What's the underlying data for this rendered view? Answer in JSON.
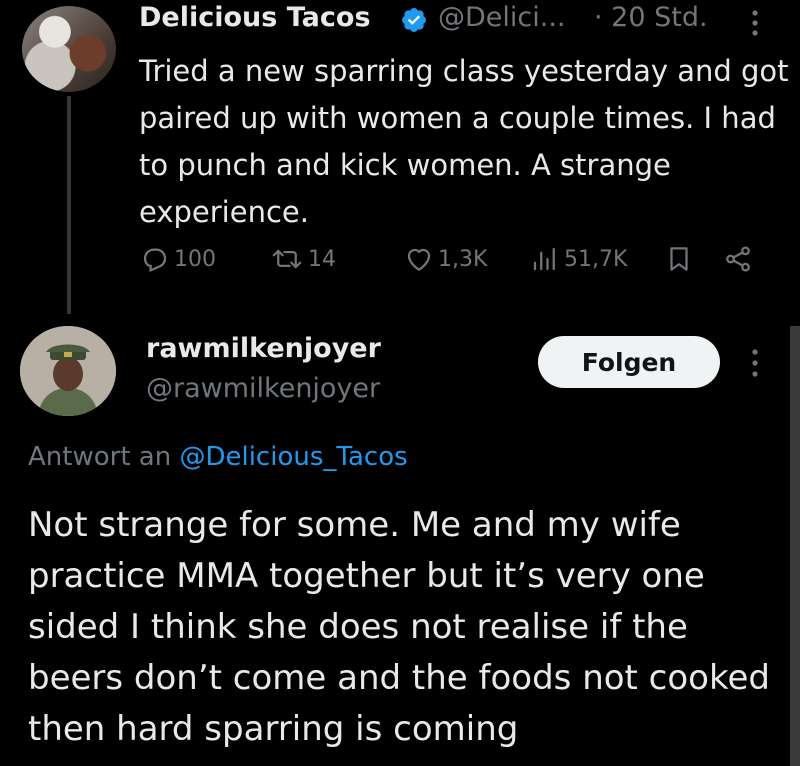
{
  "parent_tweet": {
    "author_name": "Delicious Tacos",
    "handle": "@Delici...",
    "separator": "·",
    "time": "20 Std.",
    "text": "Tried a new sparring class yesterday and got paired up with women a couple times. I had to punch and kick women. A strange experience.",
    "stats": {
      "replies": "100",
      "retweets": "14",
      "likes": "1,3K",
      "views": "51,7K"
    },
    "avatar_icon": "profile-photo",
    "verified_icon": "verified-badge-icon"
  },
  "reply_tweet": {
    "author_name": "rawmilkenjoyer",
    "handle": "@rawmilkenjoyer",
    "follow_label": "Folgen",
    "reply_prefix": "Antwort an",
    "reply_mention": "@Delicious_Tacos",
    "text": "Not strange for some. Me and my wife practice MMA together but it’s very one sided I think she does not realise if the beers don’t come and the foods not cooked then hard sparring is coming",
    "avatar_icon": "profile-photo"
  },
  "colors": {
    "background": "#000000",
    "primary_text": "#e7e9ea",
    "secondary_text": "#71767b",
    "accent": "#1d9bf0",
    "thread_line": "#333639",
    "follow_button_bg": "#eff3f4"
  }
}
